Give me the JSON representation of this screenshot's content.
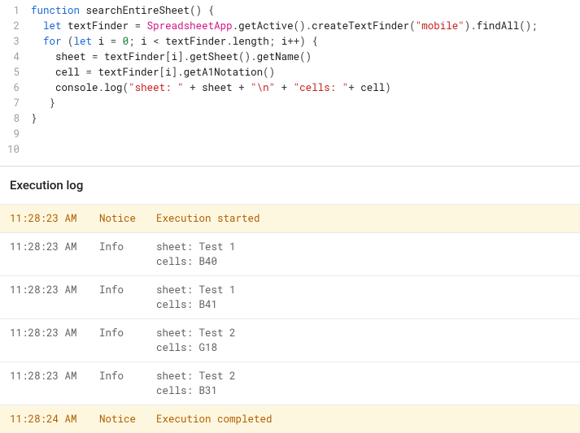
{
  "code": {
    "lines": [
      {
        "n": "1",
        "tokens": [
          [
            "kw",
            "function"
          ],
          [
            "pun",
            " "
          ],
          [
            "fn",
            "searchEntireSheet"
          ],
          [
            "pun",
            "() {"
          ]
        ]
      },
      {
        "n": "2",
        "tokens": [
          [
            "pun",
            "  "
          ],
          [
            "kw",
            "let"
          ],
          [
            "pun",
            " "
          ],
          [
            "fn",
            "textFinder"
          ],
          [
            "pun",
            " = "
          ],
          [
            "cls",
            "SpreadsheetApp"
          ],
          [
            "pun",
            "."
          ],
          [
            "fn",
            "getActive"
          ],
          [
            "pun",
            "()."
          ],
          [
            "fn",
            "createTextFinder"
          ],
          [
            "pun",
            "("
          ],
          [
            "str",
            "\"mobile\""
          ],
          [
            "pun",
            ")."
          ],
          [
            "fn",
            "findAll"
          ],
          [
            "pun",
            "();"
          ]
        ]
      },
      {
        "n": "3",
        "tokens": [
          [
            "pun",
            ""
          ]
        ]
      },
      {
        "n": "4",
        "tokens": [
          [
            "pun",
            "  "
          ],
          [
            "kw",
            "for"
          ],
          [
            "pun",
            " ("
          ],
          [
            "kw",
            "let"
          ],
          [
            "pun",
            " "
          ],
          [
            "fn",
            "i"
          ],
          [
            "pun",
            " = "
          ],
          [
            "num",
            "0"
          ],
          [
            "pun",
            "; "
          ],
          [
            "fn",
            "i"
          ],
          [
            "pun",
            " < "
          ],
          [
            "fn",
            "textFinder"
          ],
          [
            "pun",
            "."
          ],
          [
            "fn",
            "length"
          ],
          [
            "pun",
            "; "
          ],
          [
            "fn",
            "i"
          ],
          [
            "pun",
            "++) {"
          ]
        ]
      },
      {
        "n": "5",
        "tokens": [
          [
            "pun",
            "    "
          ],
          [
            "fn",
            "sheet"
          ],
          [
            "pun",
            " = "
          ],
          [
            "fn",
            "textFinder"
          ],
          [
            "pun",
            "["
          ],
          [
            "fn",
            "i"
          ],
          [
            "pun",
            "]."
          ],
          [
            "fn",
            "getSheet"
          ],
          [
            "pun",
            "()."
          ],
          [
            "fn",
            "getName"
          ],
          [
            "pun",
            "()"
          ]
        ]
      },
      {
        "n": "6",
        "tokens": [
          [
            "pun",
            "    "
          ],
          [
            "fn",
            "cell"
          ],
          [
            "pun",
            " = "
          ],
          [
            "fn",
            "textFinder"
          ],
          [
            "pun",
            "["
          ],
          [
            "fn",
            "i"
          ],
          [
            "pun",
            "]."
          ],
          [
            "fn",
            "getA1Notation"
          ],
          [
            "pun",
            "()"
          ]
        ]
      },
      {
        "n": "7",
        "tokens": [
          [
            "pun",
            "    "
          ],
          [
            "fn",
            "console"
          ],
          [
            "pun",
            "."
          ],
          [
            "fn",
            "log"
          ],
          [
            "pun",
            "("
          ],
          [
            "str",
            "\"sheet: \""
          ],
          [
            "pun",
            " + "
          ],
          [
            "fn",
            "sheet"
          ],
          [
            "pun",
            " + "
          ],
          [
            "str",
            "\"\\n\""
          ],
          [
            "pun",
            " + "
          ],
          [
            "str",
            "\"cells: \""
          ],
          [
            "pun",
            "+ "
          ],
          [
            "fn",
            "cell"
          ],
          [
            "pun",
            ")"
          ]
        ]
      },
      {
        "n": "8",
        "tokens": [
          [
            "pun",
            "   }"
          ]
        ]
      },
      {
        "n": "9",
        "tokens": [
          [
            "pun",
            "}"
          ]
        ]
      },
      {
        "n": "10",
        "tokens": [
          [
            "pun",
            ""
          ]
        ]
      }
    ]
  },
  "log": {
    "title": "Execution log",
    "rows": [
      {
        "time": "11:28:23 AM",
        "level": "Notice",
        "msg": "Execution started",
        "kind": "notice"
      },
      {
        "time": "11:28:23 AM",
        "level": "Info",
        "msg": "sheet: Test 1\ncells: B40",
        "kind": "info"
      },
      {
        "time": "11:28:23 AM",
        "level": "Info",
        "msg": "sheet: Test 1\ncells: B41",
        "kind": "info"
      },
      {
        "time": "11:28:23 AM",
        "level": "Info",
        "msg": "sheet: Test 2\ncells: G18",
        "kind": "info"
      },
      {
        "time": "11:28:23 AM",
        "level": "Info",
        "msg": "sheet: Test 2\ncells: B31",
        "kind": "info"
      },
      {
        "time": "11:28:24 AM",
        "level": "Notice",
        "msg": "Execution completed",
        "kind": "notice"
      }
    ]
  }
}
